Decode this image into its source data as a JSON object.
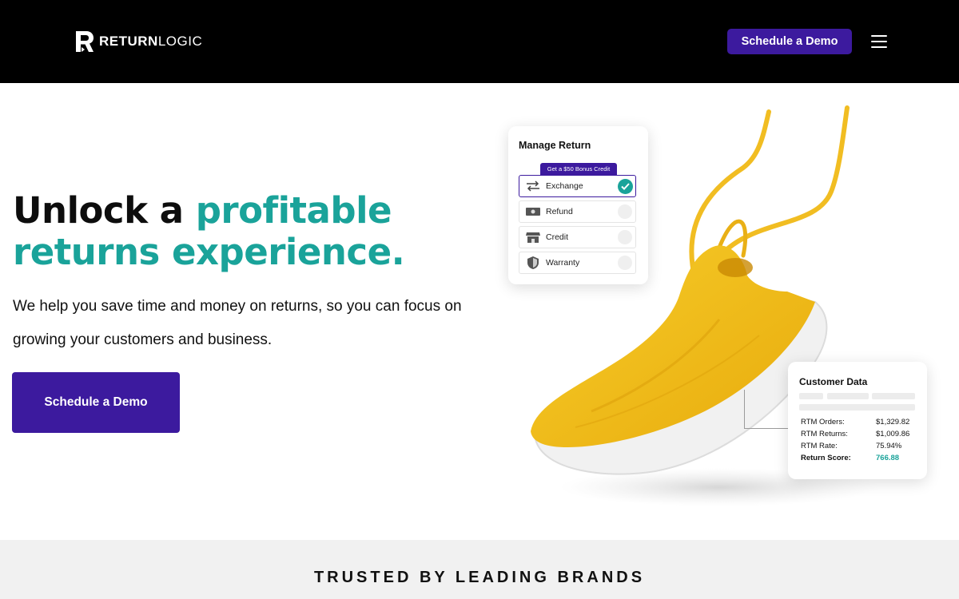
{
  "header": {
    "logo_strong": "RETURN",
    "logo_light": "LOGIC",
    "cta_label": "Schedule a Demo",
    "menu_icon": "hamburger-icon"
  },
  "hero": {
    "headline_part1": "Unlock a ",
    "headline_accent": "profitable returns experience.",
    "subtext": "We help you save time and money on returns, so you can focus on growing your customers and business.",
    "cta_label": "Schedule a Demo"
  },
  "manage_return": {
    "title": "Manage Return",
    "bonus_label": "Get a $50 Bonus Credit",
    "options": [
      {
        "label": "Exchange",
        "icon": "exchange-arrows-icon",
        "selected": true
      },
      {
        "label": "Refund",
        "icon": "cash-icon",
        "selected": false
      },
      {
        "label": "Credit",
        "icon": "store-icon",
        "selected": false
      },
      {
        "label": "Warranty",
        "icon": "shield-icon",
        "selected": false
      }
    ]
  },
  "customer_data": {
    "title": "Customer Data",
    "rows": [
      {
        "label": "RTM Orders:",
        "value": "$1,329.82"
      },
      {
        "label": "RTM Returns:",
        "value": "$1,009.86"
      },
      {
        "label": "RTM Rate:",
        "value": "75.94%"
      },
      {
        "label": "Return Score:",
        "value": "766.88"
      }
    ]
  },
  "trusted": {
    "title": "TRUSTED BY LEADING BRANDS"
  },
  "colors": {
    "brand_purple": "#3c1a9e",
    "accent_teal": "#1aa39a",
    "shoe_yellow": "#f2bf1c",
    "header_bg": "#000000"
  }
}
